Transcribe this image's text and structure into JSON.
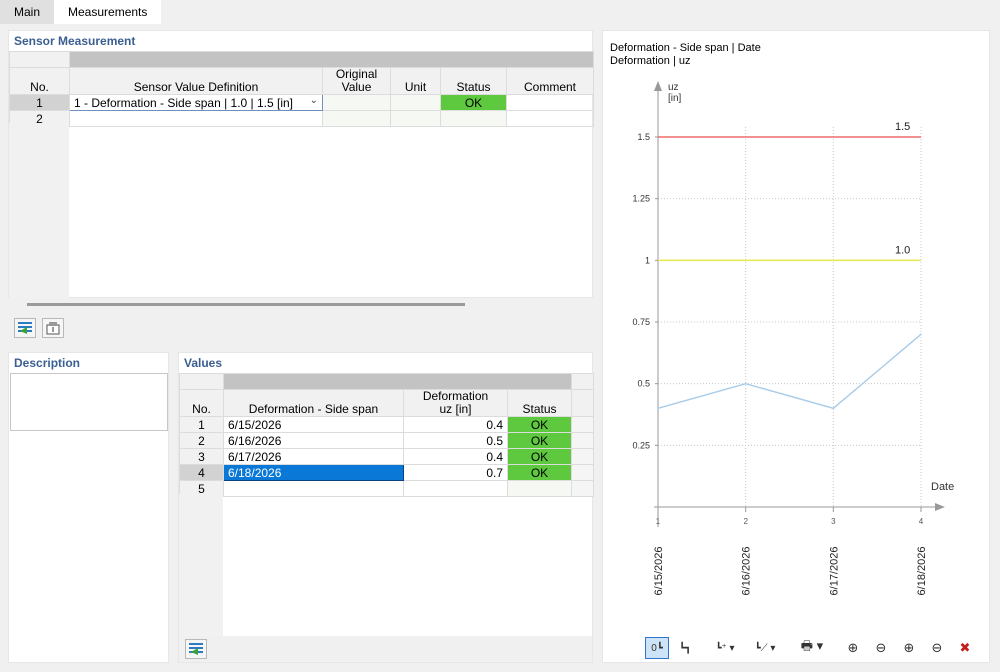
{
  "tabs": [
    "Main",
    "Measurements"
  ],
  "sensor": {
    "title": "Sensor Measurement",
    "headers": {
      "no": "No.",
      "definition": "Sensor Value Definition",
      "original_l1": "Original",
      "original_l2": "Value",
      "unit": "Unit",
      "status": "Status",
      "comment": "Comment"
    },
    "rows": [
      {
        "no": "1",
        "definition": "1 - Deformation - Side span | 1.0 | 1.5 [in]",
        "original": "",
        "unit": "",
        "status": "OK",
        "comment": ""
      },
      {
        "no": "2",
        "definition": "",
        "original": "",
        "unit": "",
        "status": "",
        "comment": ""
      }
    ]
  },
  "description": {
    "title": "Description",
    "text": ""
  },
  "values": {
    "title": "Values",
    "headers": {
      "no": "No.",
      "date": "Deformation - Side span",
      "def_l1": "Deformation",
      "def_l2": "uz [in]",
      "status": "Status"
    },
    "rows": [
      {
        "no": "1",
        "date": "6/15/2026",
        "value": "0.4",
        "status": "OK"
      },
      {
        "no": "2",
        "date": "6/16/2026",
        "value": "0.5",
        "status": "OK"
      },
      {
        "no": "3",
        "date": "6/17/2026",
        "value": "0.4",
        "status": "OK"
      },
      {
        "no": "4",
        "date": "6/18/2026",
        "value": "0.7",
        "status": "OK"
      },
      {
        "no": "5",
        "date": "",
        "value": "",
        "status": ""
      }
    ]
  },
  "colors": {
    "ok": "#5ec93e",
    "selected_row": "#0a78d7",
    "line": "#a8cbe8",
    "limit_upper": "#ef6b6b",
    "limit_lower": "#e8e85a",
    "panel_title": "#3b5f91"
  },
  "chart_data": {
    "type": "line",
    "title": "Deformation - Side span | Date",
    "subtitle": "Deformation | uz",
    "ylabel_l1": "uz",
    "ylabel_l2": "[in]",
    "xlabel": "Date",
    "x": [
      1,
      2,
      3,
      4
    ],
    "categories": [
      "6/15/2026",
      "6/16/2026",
      "6/17/2026",
      "6/18/2026"
    ],
    "series": [
      {
        "values": [
          0.4,
          0.5,
          0.4,
          0.7
        ]
      }
    ],
    "limits": [
      {
        "value": 1.5,
        "label": "1.5"
      },
      {
        "value": 1.0,
        "label": "1.0"
      }
    ],
    "yticks": [
      0.25,
      0.5,
      0.75,
      1,
      1.25,
      1.5
    ],
    "ylim": [
      0,
      1.5
    ],
    "grid": true
  },
  "chart_toolbar": [
    "axes-icon",
    "fit-icon",
    "axis-add-icon",
    "trend-icon",
    "print-icon",
    "zoom-in-x-icon",
    "zoom-out-x-icon",
    "zoom-in-y-icon",
    "zoom-out-y-icon",
    "zoom-reset-icon"
  ]
}
